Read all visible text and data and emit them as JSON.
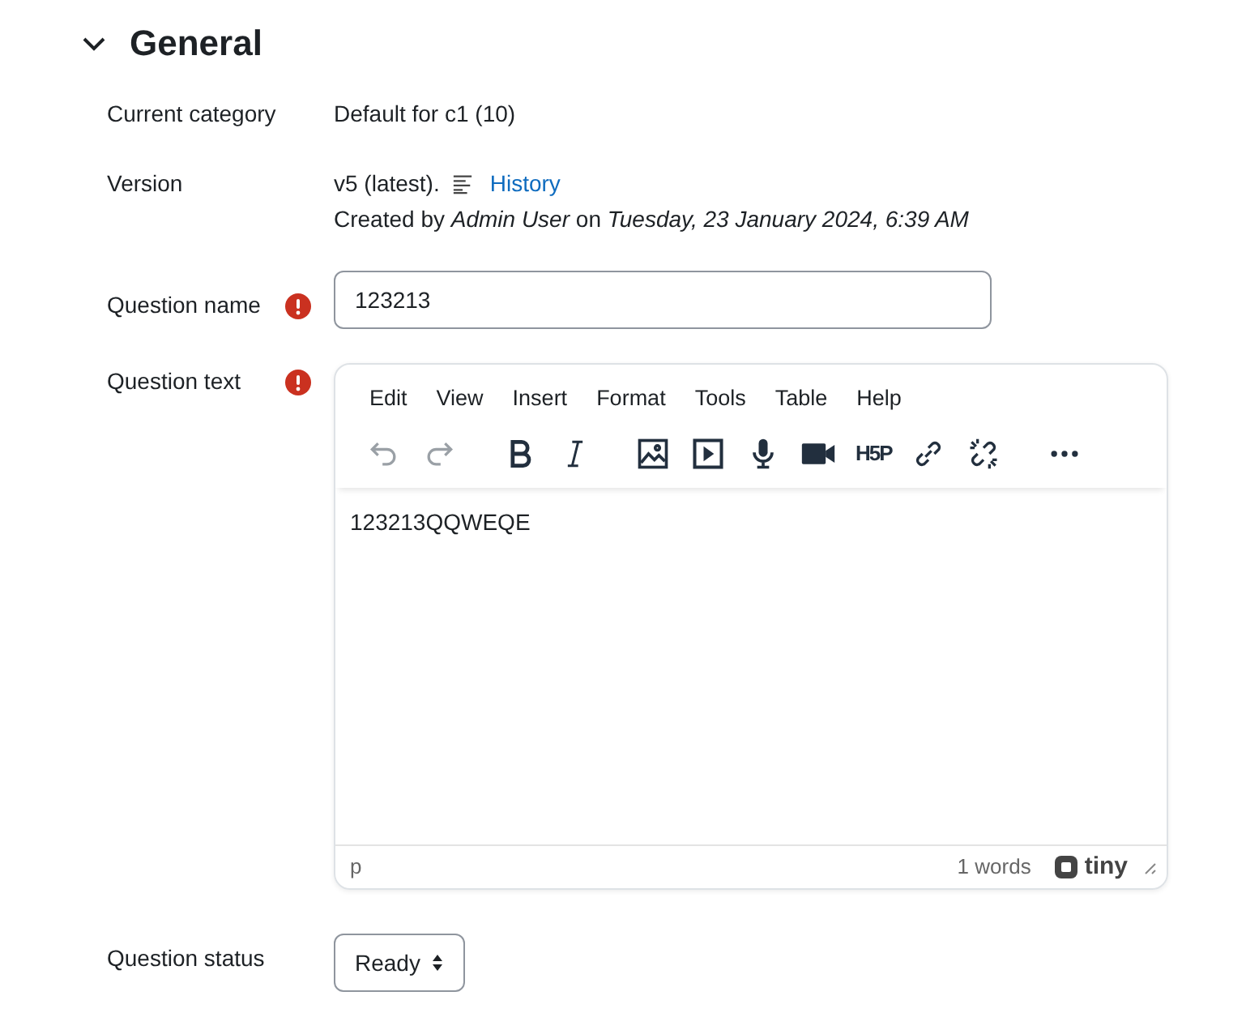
{
  "section": {
    "title": "General",
    "expanded": true
  },
  "rows": [
    {
      "kind": "text",
      "label": "Current category",
      "value": "Default for c1 (10)",
      "required": false
    },
    {
      "kind": "version",
      "label": "Version",
      "value": "v5 (latest).",
      "link": "History",
      "created_prefix": "Created by",
      "author": "Admin User",
      "on": "on",
      "date": "Tuesday, 23 January 2024, 6:39 AM",
      "required": false
    },
    {
      "kind": "input",
      "label": "Question name",
      "value": "123213",
      "required": true
    },
    {
      "kind": "editor",
      "label": "Question text",
      "required": true
    },
    {
      "kind": "select",
      "label": "Question status",
      "value": "Ready",
      "required": false
    }
  ],
  "editor": {
    "menu": [
      "Edit",
      "View",
      "Insert",
      "Format",
      "Tools",
      "Table",
      "Help"
    ],
    "toolbar": [
      {
        "kind": "undo",
        "disabled": true
      },
      {
        "kind": "redo",
        "disabled": true
      },
      {
        "kind": "bold",
        "disabled": false
      },
      {
        "kind": "italic",
        "disabled": false
      },
      {
        "kind": "image",
        "disabled": false
      },
      {
        "kind": "media",
        "disabled": false
      },
      {
        "kind": "mic",
        "disabled": false
      },
      {
        "kind": "video",
        "disabled": false
      },
      {
        "kind": "h5p",
        "label": "H5P",
        "disabled": false
      },
      {
        "kind": "link",
        "disabled": false
      },
      {
        "kind": "unlink",
        "disabled": false
      },
      {
        "kind": "more",
        "disabled": false
      }
    ],
    "content": "123213QQWEQE",
    "path": "p",
    "word_count": "1 words",
    "brand": "tiny"
  }
}
